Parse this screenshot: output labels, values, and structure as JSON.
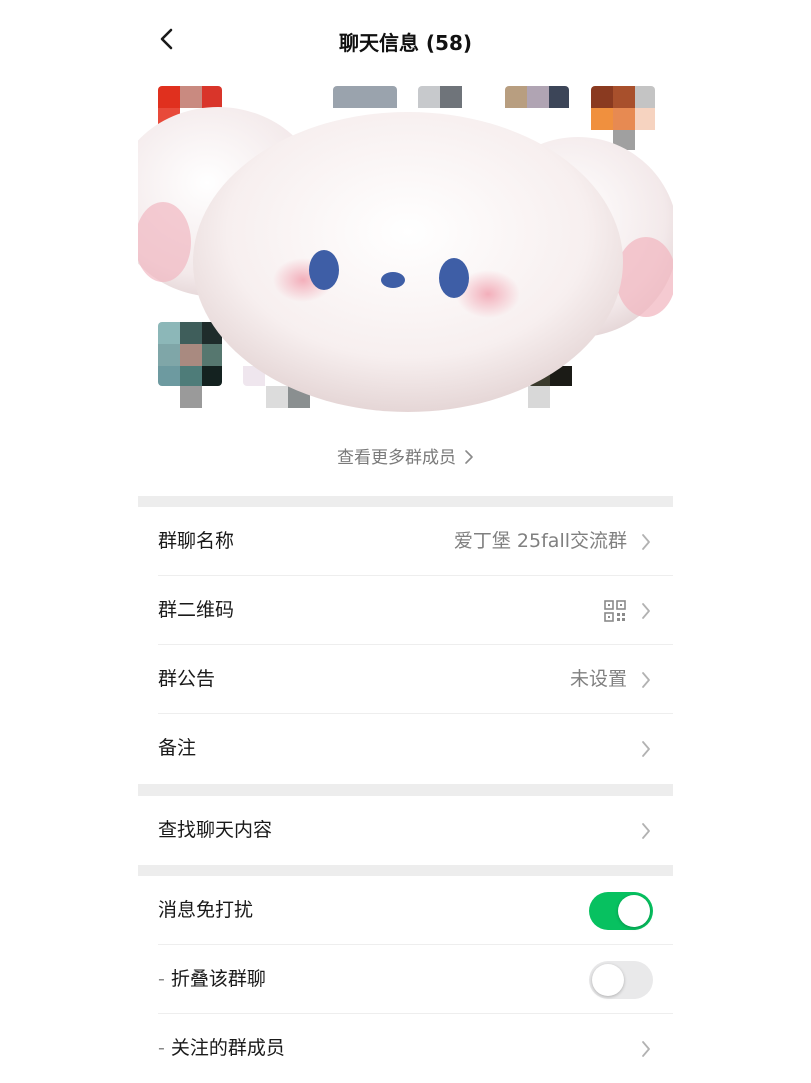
{
  "header": {
    "title": "聊天信息 (58)"
  },
  "members": {
    "more_label": "查看更多群成员"
  },
  "settings_group1": [
    {
      "label": "群聊名称",
      "value": "爱丁堡 25fall交流群"
    },
    {
      "label": "群二维码",
      "value": ""
    },
    {
      "label": "群公告",
      "value": "未设置"
    },
    {
      "label": "备注",
      "value": ""
    }
  ],
  "settings_group2": [
    {
      "label": "查找聊天内容"
    }
  ],
  "settings_group3": {
    "mute": {
      "label": "消息免打扰",
      "enabled": true
    },
    "fold": {
      "label": "折叠该群聊",
      "enabled": false
    },
    "starred": {
      "label": "关注的群成员"
    }
  },
  "icons": {
    "back": "chevron-left-icon",
    "chevron": "chevron-right-icon",
    "qr": "qr-code-icon"
  },
  "colors": {
    "toggle_on": "#07c160",
    "toggle_off": "#e9e9ea",
    "separator": "#ededed"
  }
}
